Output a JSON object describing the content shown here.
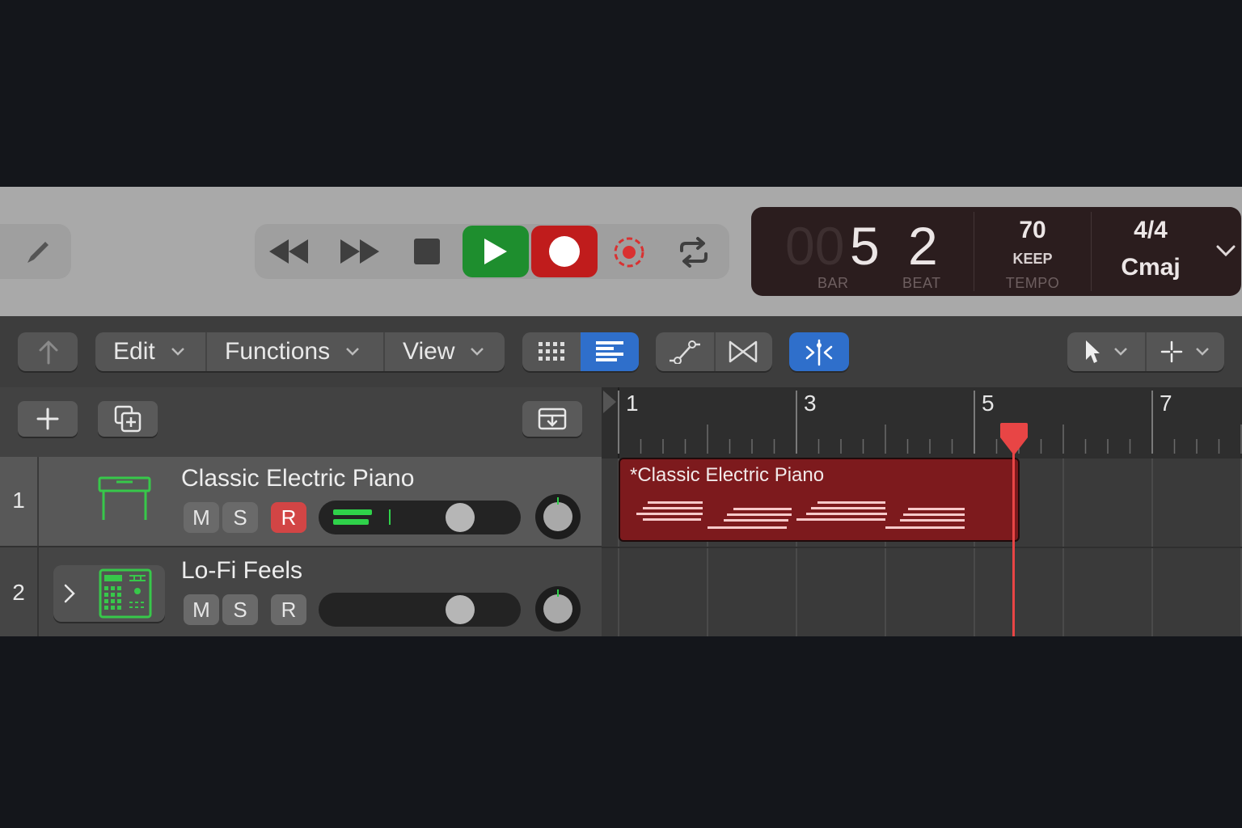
{
  "transport": {
    "buttons": [
      "rewind",
      "fast-forward",
      "stop",
      "play",
      "record",
      "capture-recording",
      "cycle"
    ],
    "colors": {
      "play": "#1e8e2e",
      "record": "#c01c1c",
      "capture": "#d93131"
    }
  },
  "lcd": {
    "bar_dim": "00",
    "bar": "5",
    "beat": "2",
    "bar_label": "BAR",
    "beat_label": "BEAT",
    "tempo": "70",
    "tempo_mode": "KEEP",
    "tempo_label": "TEMPO",
    "time_signature": "4/4",
    "key": "Cmaj"
  },
  "toolbar": {
    "menus": {
      "edit": "Edit",
      "functions": "Functions",
      "view": "View"
    }
  },
  "ruler": {
    "markers": [
      "1",
      "3",
      "5",
      "7"
    ],
    "playhead_color": "#e84545"
  },
  "tracks": [
    {
      "number": "1",
      "name": "Classic Electric Piano",
      "mute": "M",
      "solo": "S",
      "record": "R",
      "record_armed": true,
      "icon": "electric-piano-icon"
    },
    {
      "number": "2",
      "name": "Lo-Fi Feels",
      "mute": "M",
      "solo": "S",
      "record": "R",
      "record_armed": false,
      "icon": "drum-machine-icon"
    }
  ],
  "region": {
    "name": "*Classic Electric Piano",
    "color": "#7d1a1d"
  }
}
